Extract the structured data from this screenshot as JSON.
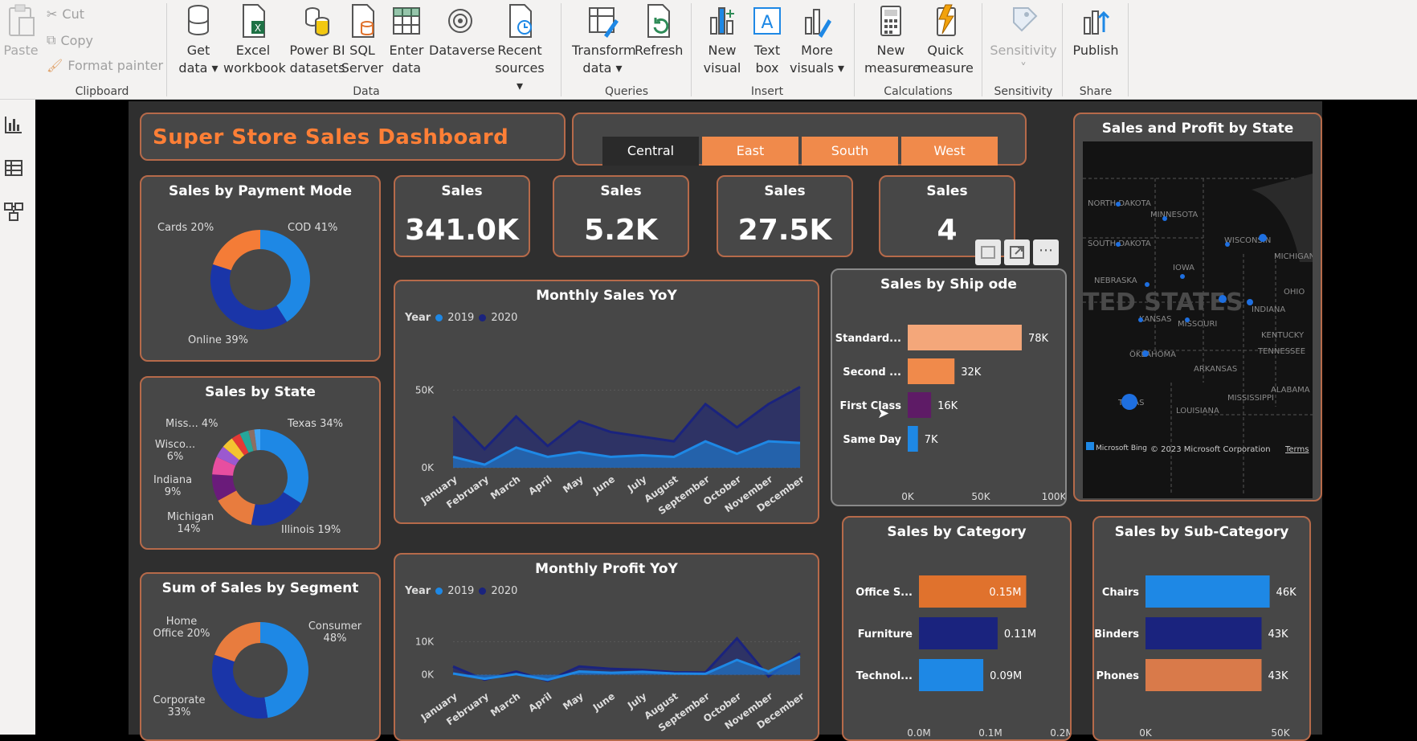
{
  "ribbon": {
    "clipboard": {
      "paste": "Paste",
      "cut": "Cut",
      "copy": "Copy",
      "format_painter": "Format painter",
      "group": "Clipboard"
    },
    "data": {
      "get_data": [
        "Get",
        "data"
      ],
      "excel": [
        "Excel",
        "workbook"
      ],
      "pbi": [
        "Power BI",
        "datasets"
      ],
      "sql": [
        "SQL",
        "Server"
      ],
      "enter": [
        "Enter",
        "data"
      ],
      "dataverse": "Dataverse",
      "recent": [
        "Recent",
        "sources"
      ],
      "group": "Data"
    },
    "queries": {
      "transform": [
        "Transform",
        "data"
      ],
      "refresh": "Refresh",
      "group": "Queries"
    },
    "insert": {
      "new_visual": [
        "New",
        "visual"
      ],
      "text_box": [
        "Text",
        "box"
      ],
      "more_visuals": [
        "More",
        "visuals"
      ],
      "group": "Insert"
    },
    "calc": {
      "new_measure": [
        "New",
        "measure"
      ],
      "quick_measure": [
        "Quick",
        "measure"
      ],
      "group": "Calculations"
    },
    "sens": {
      "label": "Sensitivity",
      "group": "Sensitivity"
    },
    "share": {
      "publish": "Publish",
      "group": "Share"
    }
  },
  "dashboard": {
    "title": "Super Store Sales Dashboard",
    "regions": [
      "Central",
      "East",
      "South",
      "West"
    ],
    "selected_region": "Central",
    "kpis": [
      {
        "label": "Sales",
        "value": "341.0K"
      },
      {
        "label": "Sales",
        "value": "5.2K"
      },
      {
        "label": "Sales",
        "value": "27.5K"
      },
      {
        "label": "Sales",
        "value": "4"
      }
    ],
    "colors": {
      "accent": "#ff7f36",
      "orange": "#f08a4b",
      "navy": "#1a237e",
      "blue": "#1e88e5",
      "card": "#474747",
      "border": "#b66a4a"
    }
  },
  "chart_data": [
    {
      "type": "pie",
      "title": "Sales by Payment Mode",
      "labels": [
        "COD 41%",
        "Online 39%",
        "Cards 20%"
      ],
      "values": [
        41,
        39,
        20
      ],
      "colors": [
        "#1e88e5",
        "#1a35a8",
        "#f47c37"
      ]
    },
    {
      "type": "pie",
      "title": "Sales by State",
      "labels": [
        "Texas 34%",
        "Illinois 19%",
        "Michigan 14%",
        "Indiana 9%",
        "Wisco... 6%",
        "Miss... 4%"
      ],
      "values": [
        34,
        19,
        14,
        9,
        6,
        4,
        4,
        3,
        3,
        2,
        2
      ],
      "colors": [
        "#1e88e5",
        "#1a35a8",
        "#e87c3e",
        "#6a1b7a",
        "#e74ea0",
        "#9b59d0",
        "#f4c430",
        "#e53935",
        "#26a69a",
        "#8d6e63",
        "#42a5f5"
      ]
    },
    {
      "type": "pie",
      "title": "Sum of Sales by Segment",
      "labels": [
        "Consumer 48%",
        "Corporate 33%",
        "Home Office 20%"
      ],
      "values": [
        48,
        33,
        20
      ],
      "colors": [
        "#1e88e5",
        "#1a35a8",
        "#e87c3e"
      ]
    },
    {
      "type": "area",
      "title": "Monthly Sales YoY",
      "legend_title": "Year",
      "x": [
        "January",
        "February",
        "March",
        "April",
        "May",
        "June",
        "July",
        "August",
        "September",
        "October",
        "November",
        "December"
      ],
      "yticks": [
        "50K",
        "0K"
      ],
      "ylim": [
        0,
        60000
      ],
      "series": [
        {
          "name": "2019",
          "color": "#1e88e5",
          "values": [
            7000,
            2000,
            13000,
            7000,
            10000,
            7000,
            8000,
            7000,
            17000,
            9000,
            17000,
            16000
          ]
        },
        {
          "name": "2020",
          "color": "#1a237e",
          "values": [
            33000,
            12000,
            33000,
            14000,
            30000,
            23000,
            20000,
            17000,
            41000,
            26000,
            41000,
            52000
          ]
        }
      ]
    },
    {
      "type": "area",
      "title": "Monthly Profit YoY",
      "legend_title": "Year",
      "x": [
        "January",
        "February",
        "March",
        "April",
        "May",
        "June",
        "July",
        "August",
        "September",
        "October",
        "November",
        "December"
      ],
      "yticks": [
        "10K",
        "0K"
      ],
      "ylim": [
        -3000,
        13000
      ],
      "series": [
        {
          "name": "2019",
          "color": "#1e88e5",
          "values": [
            400,
            -1200,
            200,
            -1500,
            1000,
            600,
            900,
            400,
            300,
            4500,
            1000,
            5500
          ]
        },
        {
          "name": "2020",
          "color": "#1a237e",
          "values": [
            2500,
            -1500,
            1000,
            -1800,
            2500,
            1800,
            1500,
            800,
            700,
            11000,
            -500,
            6500
          ]
        }
      ]
    },
    {
      "type": "bar",
      "title": "Sales by Ship ode",
      "categories": [
        "Standard...",
        "Second ...",
        "First Class",
        "Same Day"
      ],
      "values": [
        78000,
        32000,
        16000,
        7000
      ],
      "labels": [
        "78K",
        "32K",
        "16K",
        "7K"
      ],
      "colors": [
        "#f4a77a",
        "#f08a4b",
        "#5e1b66",
        "#1e88e5"
      ],
      "xticks": [
        "0K",
        "50K",
        "100K"
      ],
      "xlim": [
        0,
        100000
      ]
    },
    {
      "type": "bar",
      "title": "Sales by Category",
      "categories": [
        "Office S...",
        "Furniture",
        "Technol..."
      ],
      "values": [
        0.15,
        0.11,
        0.09
      ],
      "labels": [
        "0.15M",
        "0.11M",
        "0.09M"
      ],
      "colors": [
        "#e0722d",
        "#1a237e",
        "#1e88e5"
      ],
      "xticks": [
        "0.0M",
        "0.1M",
        "0.2M"
      ],
      "xlim": [
        0,
        0.2
      ]
    },
    {
      "type": "bar",
      "title": "Sales by Sub-Category",
      "categories": [
        "Chairs",
        "Binders",
        "Phones"
      ],
      "values": [
        46,
        43,
        43
      ],
      "labels": [
        "46K",
        "43K",
        "43K"
      ],
      "colors": [
        "#1e88e5",
        "#1a237e",
        "#d97a4a"
      ],
      "xticks": [
        "0K",
        "50K"
      ],
      "xlim": [
        0,
        50
      ]
    }
  ],
  "map": {
    "title": "Sales and Profit by State",
    "country": "TED STATES",
    "states": [
      "NORTH DAKOTA",
      "MINNESOTA",
      "SOUTH DAKOTA",
      "WISCONSIN",
      "MICHIGAN",
      "IOWA",
      "NEBRASKA",
      "KANSAS",
      "MISSOURI",
      "INDIANA",
      "OHIO",
      "KENTUCKY",
      "OKLAHOMA",
      "TENNESSEE",
      "ARKANSAS",
      "ALABAMA",
      "MISSISSIPPI",
      "TEXAS",
      "LOUISIANA"
    ],
    "attribution": "© 2023 Microsoft Corporation",
    "bing": "Microsoft Bing",
    "terms": "Terms"
  }
}
